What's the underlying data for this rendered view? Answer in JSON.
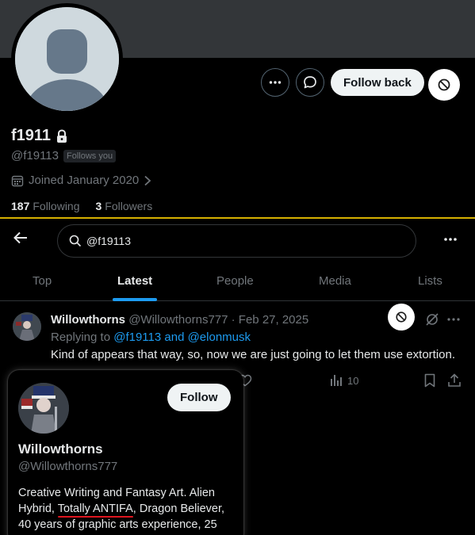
{
  "profile": {
    "display_name": "f1911",
    "handle": "@f19113",
    "follows_you": "Follows you",
    "joined": "Joined January 2020",
    "following_count": "187",
    "following_label": "Following",
    "followers_count": "3",
    "followers_label": "Followers",
    "follow_back_label": "Follow back"
  },
  "search": {
    "query": "@f19113"
  },
  "tabs": [
    {
      "label": "Top"
    },
    {
      "label": "Latest"
    },
    {
      "label": "People"
    },
    {
      "label": "Media"
    },
    {
      "label": "Lists"
    }
  ],
  "active_tab": "Latest",
  "tweet": {
    "author_name": "Willowthorns",
    "author_meta": "@Willowthorns777 · Feb 27, 2025",
    "replying_to_prefix": "Replying to",
    "replying_to_mentions": "@f19113 and @elonmusk",
    "text": "Kind of appears that way, so, now we are just going to let them use extortion.",
    "views": "10"
  },
  "hover_card": {
    "follow_label": "Follow",
    "name": "Willowthorns",
    "handle": "@Willowthorns777",
    "bio_line1": "Creative Writing and Fantasy Art. Alien",
    "bio_line2_pre": "Hybrid, ",
    "bio_line2_highlight": "Totally ANTIFA",
    "bio_line2_post": ", Dragon Believer,",
    "bio_line3": "40 years of graphic arts experience, 25"
  },
  "colors": {
    "accent": "#1d9bf0",
    "highlight_underline": "#e0151f",
    "divider": "#d6b000"
  },
  "icons": [
    "more-icon",
    "message-icon",
    "block-icon",
    "lock-icon",
    "calendar-icon",
    "chevron-right-icon",
    "back-arrow-icon",
    "search-icon",
    "grok-icon",
    "heart-icon",
    "views-icon",
    "bookmark-icon",
    "share-icon"
  ]
}
